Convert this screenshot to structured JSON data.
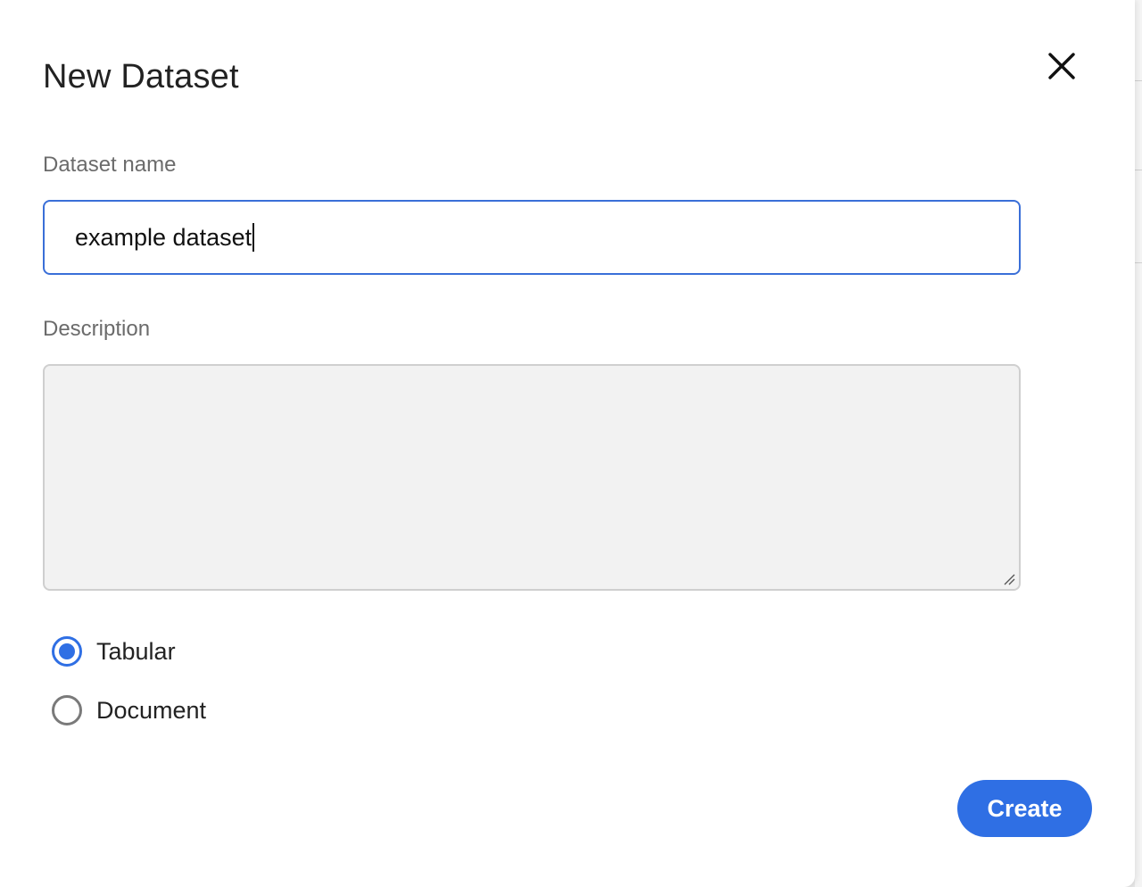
{
  "dialog": {
    "title": "New Dataset",
    "close_icon": "close-icon"
  },
  "form": {
    "name_label": "Dataset name",
    "name_value": "example dataset",
    "description_label": "Description",
    "description_value": "",
    "dataset_types": [
      {
        "label": "Tabular",
        "selected": true
      },
      {
        "label": "Document",
        "selected": false
      }
    ],
    "create_label": "Create"
  },
  "colors": {
    "accent": "#2f6fe4",
    "input_focus_border": "#3a6fd8",
    "textarea_background": "#f2f2f2",
    "label_text": "#6b6b6b"
  }
}
